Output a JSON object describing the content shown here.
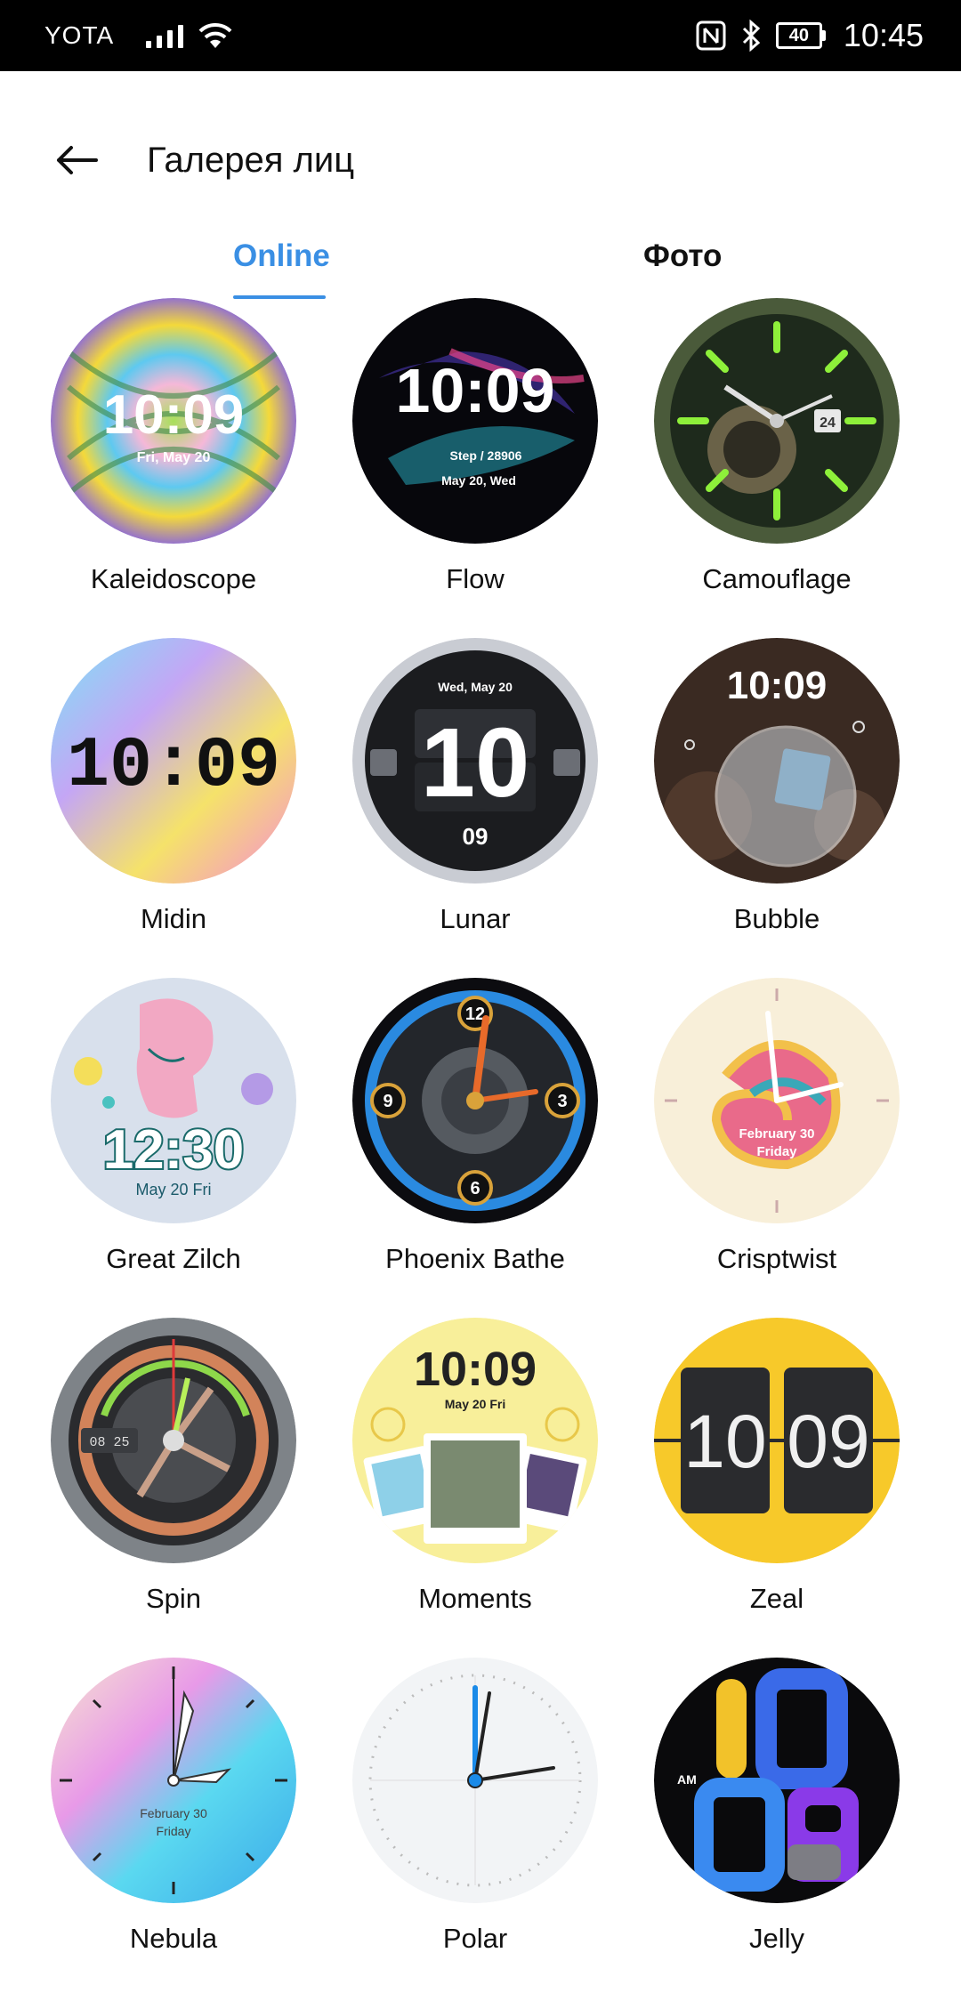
{
  "status_bar": {
    "carrier": "YOTA",
    "battery": "40",
    "time": "10:45",
    "icons": [
      "signal-icon",
      "wifi-icon",
      "nfc-icon",
      "bluetooth-icon",
      "battery-icon"
    ]
  },
  "header": {
    "title": "Галерея лиц",
    "back_icon": "arrow-left-icon"
  },
  "tabs": [
    {
      "label": "Online",
      "active": true
    },
    {
      "label": "Фото",
      "active": false
    }
  ],
  "colors": {
    "accent": "#3a8fe4",
    "status_bar_bg": "#000000",
    "background": "#ffffff"
  },
  "faces": [
    {
      "name": "Kaleidoscope",
      "time": "10:09",
      "date": "Fri, May 20"
    },
    {
      "name": "Flow",
      "time": "10:09",
      "steps": "Step / 28906",
      "date": "May 20, Wed"
    },
    {
      "name": "Camouflage",
      "day": "24"
    },
    {
      "name": "Midin",
      "time": "10:09"
    },
    {
      "name": "Lunar",
      "date": "Wed, May 20",
      "hour": "10",
      "minute": "09"
    },
    {
      "name": "Bubble",
      "time": "10:09"
    },
    {
      "name": "Great Zilch",
      "time": "12:30",
      "date": "May 20 Fri"
    },
    {
      "name": "Phoenix Bathe",
      "n12": "12",
      "n3": "3",
      "n6": "6",
      "n9": "9"
    },
    {
      "name": "Crisptwist",
      "date": "February 30",
      "day": "Friday"
    },
    {
      "name": "Spin",
      "time": "08 25"
    },
    {
      "name": "Moments",
      "time": "10:09",
      "date": "May 20 Fri"
    },
    {
      "name": "Zeal",
      "hour": "10",
      "minute": "09"
    },
    {
      "name": "Nebula",
      "date": "February 30",
      "day": "Friday"
    },
    {
      "name": "Polar"
    },
    {
      "name": "Jelly",
      "ampm": "AM",
      "hour": "10",
      "minute": "09"
    }
  ]
}
